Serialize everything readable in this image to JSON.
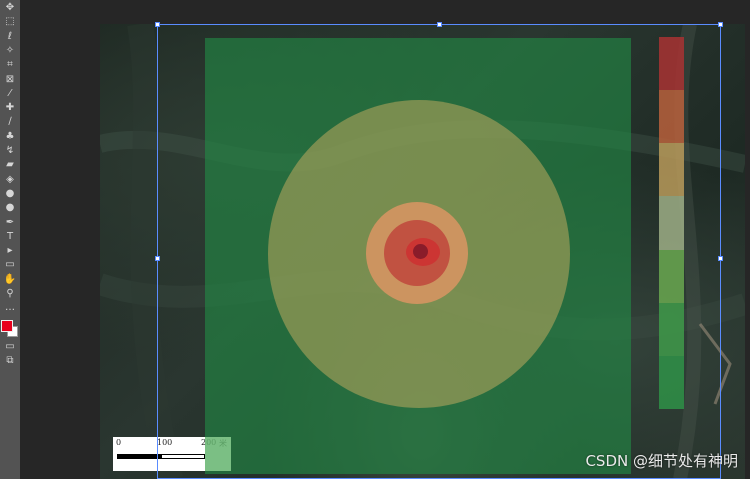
{
  "tools": [
    {
      "name": "move-tool-icon",
      "glyph": "✥"
    },
    {
      "name": "marquee-tool-icon",
      "glyph": "⬚"
    },
    {
      "name": "lasso-tool-icon",
      "glyph": "ℓ"
    },
    {
      "name": "magic-wand-tool-icon",
      "glyph": "✧"
    },
    {
      "name": "crop-tool-icon",
      "glyph": "⌗"
    },
    {
      "name": "frame-tool-icon",
      "glyph": "⊠"
    },
    {
      "name": "eyedropper-tool-icon",
      "glyph": "⁄"
    },
    {
      "name": "healing-brush-tool-icon",
      "glyph": "✚"
    },
    {
      "name": "brush-tool-icon",
      "glyph": "∕"
    },
    {
      "name": "clone-stamp-tool-icon",
      "glyph": "♣"
    },
    {
      "name": "history-brush-tool-icon",
      "glyph": "↯"
    },
    {
      "name": "eraser-tool-icon",
      "glyph": "▰"
    },
    {
      "name": "paint-bucket-tool-icon",
      "glyph": "◈"
    },
    {
      "name": "blur-tool-icon",
      "glyph": "●"
    },
    {
      "name": "dodge-tool-icon",
      "glyph": "●"
    },
    {
      "name": "pen-tool-icon",
      "glyph": "✒"
    },
    {
      "name": "type-tool-icon",
      "glyph": "T"
    },
    {
      "name": "path-selection-tool-icon",
      "glyph": "▸"
    },
    {
      "name": "rectangle-tool-icon",
      "glyph": "▭"
    },
    {
      "name": "hand-tool-icon",
      "glyph": "✋"
    },
    {
      "name": "zoom-tool-icon",
      "glyph": "⚲"
    },
    {
      "name": "more-tools-icon",
      "glyph": "…"
    }
  ],
  "colors": {
    "foreground": "#e8001c",
    "background": "#ffffff",
    "overlay": "#228b46",
    "legend": [
      "#a83232",
      "#b8603c",
      "#b89a5a",
      "#9eae86",
      "#6aa850",
      "#3f9a4a",
      "#2f9248"
    ]
  },
  "scalebar": {
    "label_0": "0",
    "label_100": "100",
    "label_200": "200",
    "unit": "米"
  },
  "watermark": "CSDN @细节处有神明"
}
